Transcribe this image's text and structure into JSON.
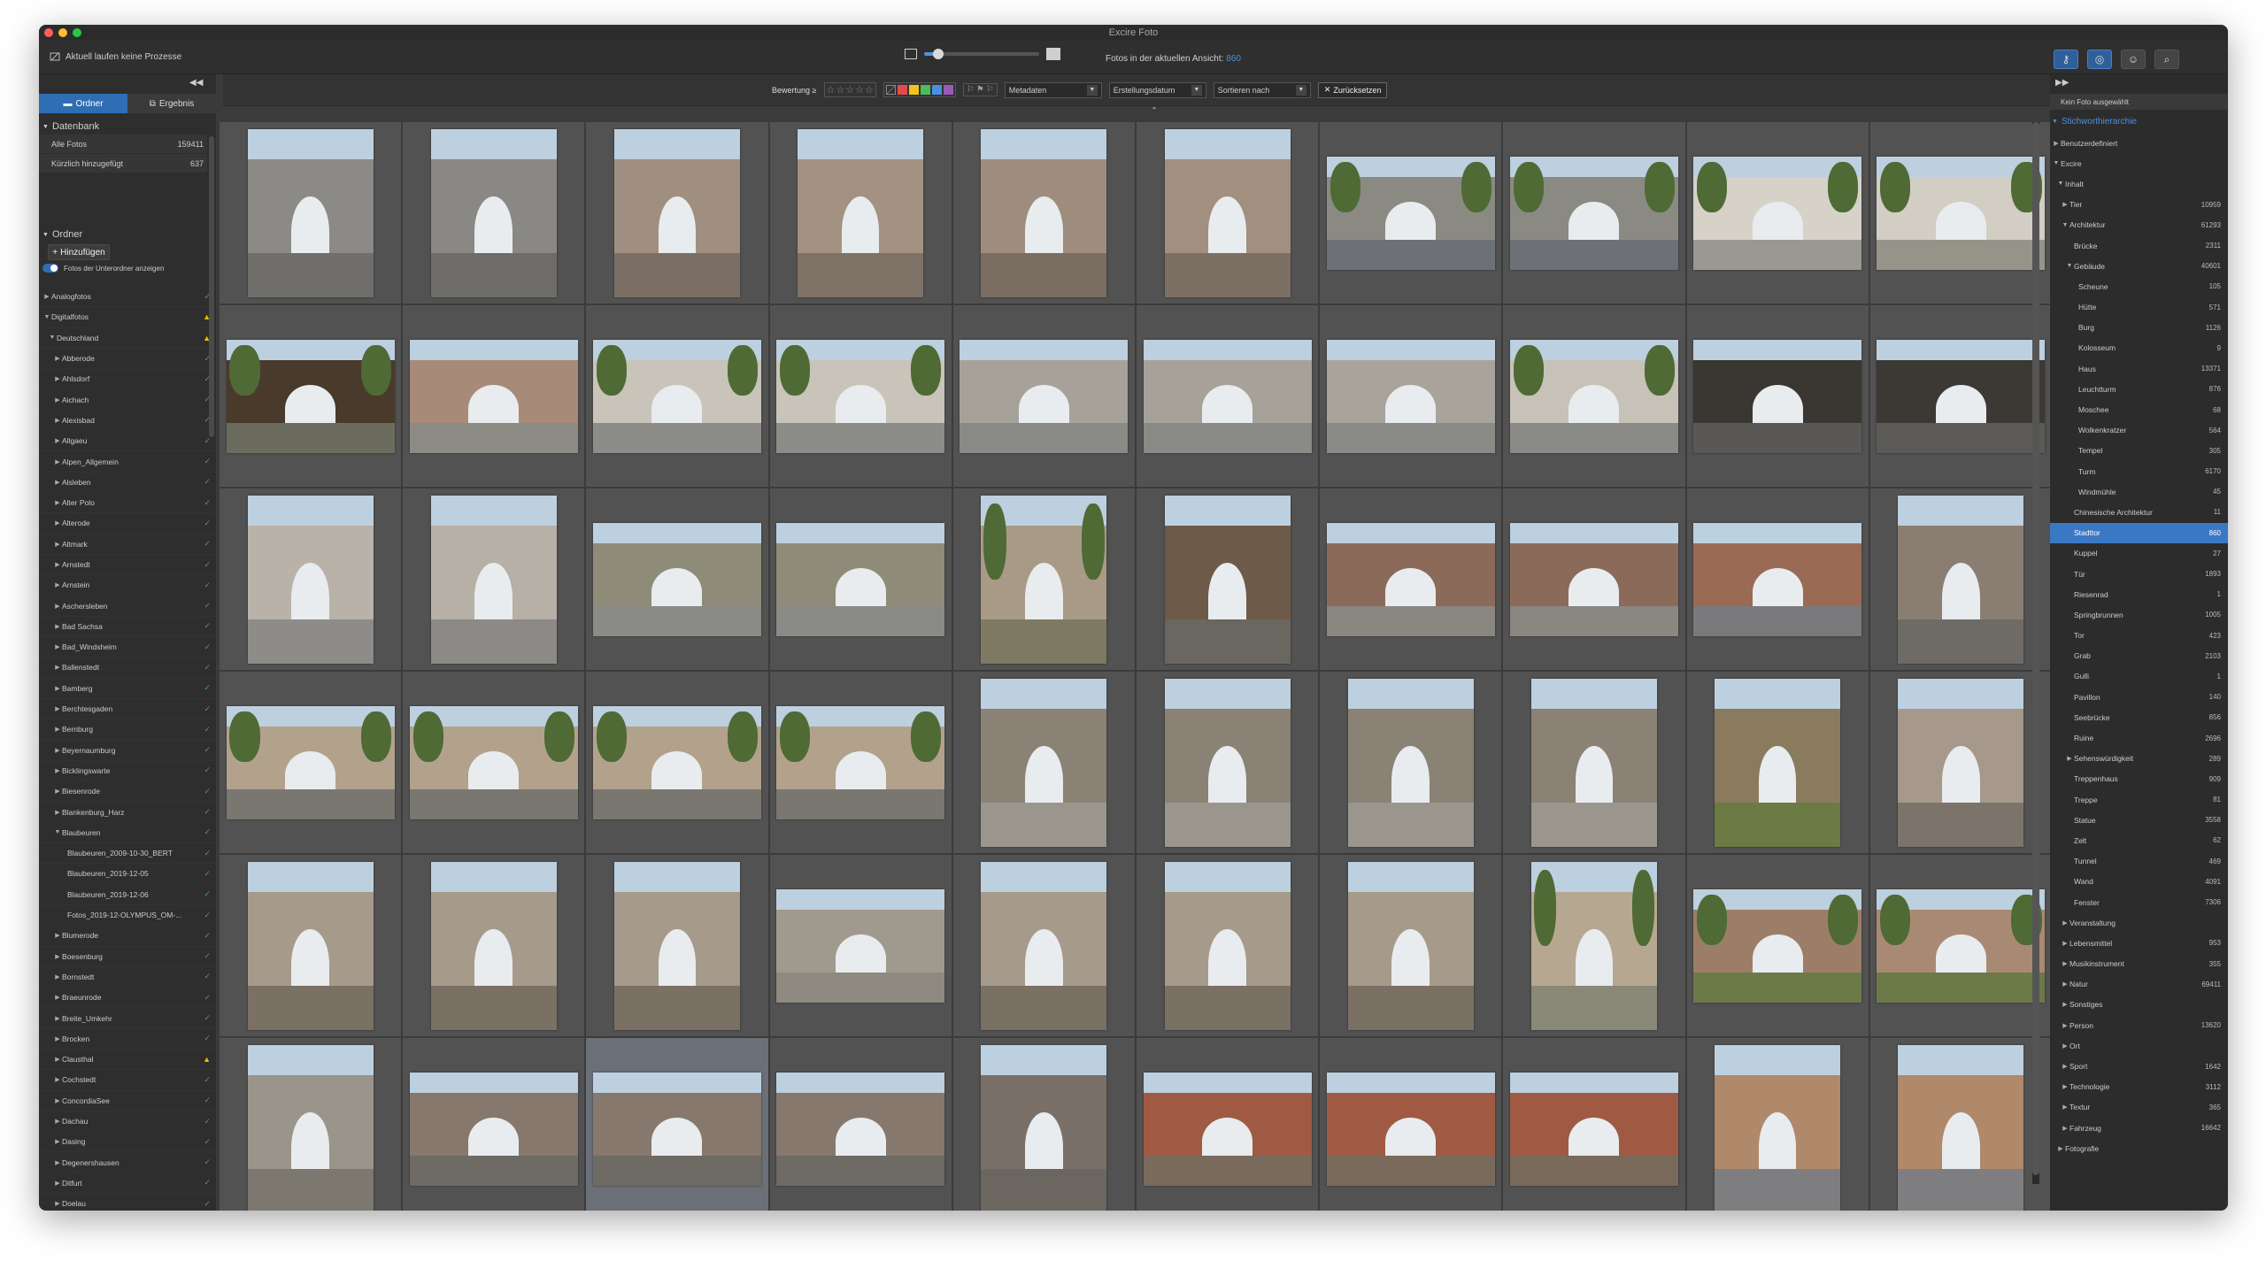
{
  "window": {
    "title": "Excire Foto",
    "traffic_colors": [
      "#ff5f57",
      "#febc2e",
      "#28c840"
    ]
  },
  "toolbar": {
    "process_status": "Aktuell laufen keine Prozesse",
    "count_label": "Fotos in der aktuellen Ansicht:",
    "count_value": "860",
    "zoom_level": 0.12,
    "right_buttons": [
      {
        "icon": "key-search-icon",
        "active": true
      },
      {
        "icon": "refresh-search-icon",
        "active": true
      },
      {
        "icon": "people-icon",
        "active": false
      },
      {
        "icon": "magnifier-icon",
        "active": false
      }
    ]
  },
  "left": {
    "tabs": [
      {
        "label": "Ordner",
        "icon": "folder-icon",
        "active": true
      },
      {
        "label": "Ergebnis",
        "icon": "results-icon",
        "active": false
      }
    ],
    "database": {
      "heading": "Datenbank",
      "rows": [
        {
          "label": "Alle Fotos",
          "count": "159411"
        },
        {
          "label": "Kürzlich hinzugefügt",
          "count": "637"
        }
      ]
    },
    "folders_heading": "Ordner",
    "add_label": "Hinzufügen",
    "subfolder_toggle": "Fotos der Unterordner anzeigen",
    "folders": [
      {
        "label": "Analogfotos",
        "level": 0,
        "arrow": "▶",
        "status": "ok"
      },
      {
        "label": "Digitalfotos",
        "level": 0,
        "arrow": "▼",
        "status": "warn"
      },
      {
        "label": "Deutschland",
        "level": 1,
        "arrow": "▼",
        "status": "warn"
      },
      {
        "label": "Abberode",
        "level": 2,
        "arrow": "▶",
        "status": "ok"
      },
      {
        "label": "Ahlsdorf",
        "level": 2,
        "arrow": "▶",
        "status": "ok"
      },
      {
        "label": "Aichach",
        "level": 2,
        "arrow": "▶",
        "status": "ok"
      },
      {
        "label": "Alexisbad",
        "level": 2,
        "arrow": "▶",
        "status": "ok"
      },
      {
        "label": "Allgaeu",
        "level": 2,
        "arrow": "▶",
        "status": "ok"
      },
      {
        "label": "Alpen_Allgemein",
        "level": 2,
        "arrow": "▶",
        "status": "ok"
      },
      {
        "label": "Alsleben",
        "level": 2,
        "arrow": "▶",
        "status": "ok"
      },
      {
        "label": "Alter Polo",
        "level": 2,
        "arrow": "▶",
        "status": "ok"
      },
      {
        "label": "Alterode",
        "level": 2,
        "arrow": "▶",
        "status": "ok"
      },
      {
        "label": "Altmark",
        "level": 2,
        "arrow": "▶",
        "status": "ok"
      },
      {
        "label": "Arnstedt",
        "level": 2,
        "arrow": "▶",
        "status": "ok"
      },
      {
        "label": "Arnstein",
        "level": 2,
        "arrow": "▶",
        "status": "ok"
      },
      {
        "label": "Aschersleben",
        "level": 2,
        "arrow": "▶",
        "status": "ok"
      },
      {
        "label": "Bad Sachsa",
        "level": 2,
        "arrow": "▶",
        "status": "ok"
      },
      {
        "label": "Bad_Windsheim",
        "level": 2,
        "arrow": "▶",
        "status": "ok"
      },
      {
        "label": "Ballenstedt",
        "level": 2,
        "arrow": "▶",
        "status": "ok"
      },
      {
        "label": "Bamberg",
        "level": 2,
        "arrow": "▶",
        "status": "ok"
      },
      {
        "label": "Berchtesgaden",
        "level": 2,
        "arrow": "▶",
        "status": "ok"
      },
      {
        "label": "Bernburg",
        "level": 2,
        "arrow": "▶",
        "status": "ok"
      },
      {
        "label": "Beyernaumburg",
        "level": 2,
        "arrow": "▶",
        "status": "ok"
      },
      {
        "label": "Bicklingswarte",
        "level": 2,
        "arrow": "▶",
        "status": "ok"
      },
      {
        "label": "Biesenrode",
        "level": 2,
        "arrow": "▶",
        "status": "ok"
      },
      {
        "label": "Blankenburg_Harz",
        "level": 2,
        "arrow": "▶",
        "status": "ok"
      },
      {
        "label": "Blaubeuren",
        "level": 2,
        "arrow": "▼",
        "status": "ok"
      },
      {
        "label": "Blaubeuren_2009-10-30_BERT",
        "level": 3,
        "arrow": "",
        "status": "ok"
      },
      {
        "label": "Blaubeuren_2019-12-05",
        "level": 3,
        "arrow": "",
        "status": "ok"
      },
      {
        "label": "Blaubeuren_2019-12-06",
        "level": 3,
        "arrow": "",
        "status": "ok"
      },
      {
        "label": "Fotos_2019-12-OLYMPUS_OM-...",
        "level": 3,
        "arrow": "",
        "status": "ok"
      },
      {
        "label": "Blumerode",
        "level": 2,
        "arrow": "▶",
        "status": "ok"
      },
      {
        "label": "Boesenburg",
        "level": 2,
        "arrow": "▶",
        "status": "ok"
      },
      {
        "label": "Bornstedt",
        "level": 2,
        "arrow": "▶",
        "status": "ok"
      },
      {
        "label": "Braeunrode",
        "level": 2,
        "arrow": "▶",
        "status": "ok"
      },
      {
        "label": "Breite_Umkehr",
        "level": 2,
        "arrow": "▶",
        "status": "ok"
      },
      {
        "label": "Brocken",
        "level": 2,
        "arrow": "▶",
        "status": "ok"
      },
      {
        "label": "Clausthal",
        "level": 2,
        "arrow": "▶",
        "status": "warn"
      },
      {
        "label": "Cochstedt",
        "level": 2,
        "arrow": "▶",
        "status": "ok"
      },
      {
        "label": "ConcordiaSee",
        "level": 2,
        "arrow": "▶",
        "status": "ok"
      },
      {
        "label": "Dachau",
        "level": 2,
        "arrow": "▶",
        "status": "ok"
      },
      {
        "label": "Dasing",
        "level": 2,
        "arrow": "▶",
        "status": "ok"
      },
      {
        "label": "Degenershausen",
        "level": 2,
        "arrow": "▶",
        "status": "ok"
      },
      {
        "label": "Ditfurt",
        "level": 2,
        "arrow": "▶",
        "status": "ok"
      },
      {
        "label": "Doelau",
        "level": 2,
        "arrow": "▶",
        "status": "ok"
      }
    ]
  },
  "filter": {
    "rating_label": "Bewertung",
    "rating_op": "≥",
    "color_labels": [
      "#e14b4b",
      "#f0c419",
      "#4cbb5c",
      "#4a90e2",
      "#9b59b6"
    ],
    "dropdowns": [
      "Metadaten",
      "Erstellungsdatum",
      "Sortieren nach"
    ],
    "reset_label": "Zurücksetzen"
  },
  "grid": {
    "selected_index": 52,
    "thumbs": [
      {
        "o": "port",
        "c": "#8c8a86",
        "g": "#6f6e6a"
      },
      {
        "o": "port",
        "c": "#8a8884",
        "g": "#6d6c68"
      },
      {
        "o": "port",
        "c": "#a08f80",
        "g": "#7b6f65"
      },
      {
        "o": "port",
        "c": "#a39281",
        "g": "#7e7166"
      },
      {
        "o": "port",
        "c": "#9e8d7e",
        "g": "#7a6d62"
      },
      {
        "o": "port",
        "c": "#a19080",
        "g": "#7c6f64"
      },
      {
        "o": "land",
        "c": "#8a8a82",
        "g": "#6d7076",
        "t": 1
      },
      {
        "o": "land",
        "c": "#8a8a82",
        "g": "#6d7076",
        "t": 1
      },
      {
        "o": "land",
        "c": "#d6d2c8",
        "g": "#9a9890",
        "t": 1
      },
      {
        "o": "land",
        "c": "#d2cec4",
        "g": "#969488",
        "t": 1
      },
      {
        "o": "land",
        "c": "#4a3a2c",
        "g": "#6c6c5e",
        "t": 1
      },
      {
        "o": "land",
        "c": "#a88a78",
        "g": "#8c8c84"
      },
      {
        "o": "land",
        "c": "#c8c4ba",
        "g": "#8c8c88",
        "t": 1
      },
      {
        "o": "land",
        "c": "#c8c4ba",
        "g": "#8c8c88",
        "t": 1
      },
      {
        "o": "land",
        "c": "#a6a29a",
        "g": "#8a8a86"
      },
      {
        "o": "land",
        "c": "#a6a29a",
        "g": "#8a8a86"
      },
      {
        "o": "land",
        "c": "#a8a49c",
        "g": "#8a8a86"
      },
      {
        "o": "land",
        "c": "#c6c2b8",
        "g": "#8a8a86",
        "t": 1
      },
      {
        "o": "land",
        "c": "#3a3632",
        "g": "#5a5854"
      },
      {
        "o": "land",
        "c": "#3c3834",
        "g": "#5c5a56"
      },
      {
        "o": "port",
        "c": "#b8b2a8",
        "g": "#8e8c88"
      },
      {
        "o": "port",
        "c": "#b6b0a6",
        "g": "#8c8a86"
      },
      {
        "o": "land",
        "c": "#8e8c78",
        "g": "#8a8a86"
      },
      {
        "o": "land",
        "c": "#8e8c78",
        "g": "#8a8a86"
      },
      {
        "o": "port",
        "c": "#a89a86",
        "g": "#7e7a62",
        "t": 1
      },
      {
        "o": "port",
        "c": "#6e5a48",
        "g": "#6a6660"
      },
      {
        "o": "land",
        "c": "#8c6a5a",
        "g": "#8a8680"
      },
      {
        "o": "land",
        "c": "#8c6a5a",
        "g": "#8a8680"
      },
      {
        "o": "land",
        "c": "#9a6a54",
        "g": "#7a7a7c"
      },
      {
        "o": "port",
        "c": "#8a7e72",
        "g": "#6e6a66"
      },
      {
        "o": "land",
        "c": "#b2a28c",
        "g": "#7a7670",
        "t": 1
      },
      {
        "o": "land",
        "c": "#b2a28c",
        "g": "#7a7670",
        "t": 1
      },
      {
        "o": "land",
        "c": "#b2a28c",
        "g": "#7a7670",
        "t": 1
      },
      {
        "o": "land",
        "c": "#b2a28c",
        "g": "#7a7670",
        "t": 1
      },
      {
        "o": "port",
        "c": "#8a8274",
        "g": "#9a968e"
      },
      {
        "o": "port",
        "c": "#8a8274",
        "g": "#9a968e"
      },
      {
        "o": "port",
        "c": "#8a8274",
        "g": "#9a968e"
      },
      {
        "o": "port",
        "c": "#8a8274",
        "g": "#9a968e"
      },
      {
        "o": "port",
        "c": "#8a7a5e",
        "g": "#6c7a44"
      },
      {
        "o": "port",
        "c": "#a6988a",
        "g": "#7c746a"
      },
      {
        "o": "port",
        "c": "#a69a8a",
        "g": "#7a7064"
      },
      {
        "o": "port",
        "c": "#a69a8a",
        "g": "#7a7064"
      },
      {
        "o": "port",
        "c": "#a69a8a",
        "g": "#7a7064"
      },
      {
        "o": "land",
        "c": "#a09a8e",
        "g": "#8e8a80"
      },
      {
        "o": "port",
        "c": "#a69a8a",
        "g": "#7a7064"
      },
      {
        "o": "port",
        "c": "#a69a8a",
        "g": "#7a7064"
      },
      {
        "o": "port",
        "c": "#a69a8a",
        "g": "#7a7064"
      },
      {
        "o": "port",
        "c": "#b6a890",
        "g": "#8a8878",
        "t": 1
      },
      {
        "o": "land",
        "c": "#9c7e68",
        "g": "#6c7a4a",
        "t": 1
      },
      {
        "o": "land",
        "c": "#a88a74",
        "g": "#6c7a4a",
        "t": 1
      },
      {
        "o": "port",
        "c": "#9a948a",
        "g": "#7c7870"
      },
      {
        "o": "land",
        "c": "#86786c",
        "g": "#6e6a64"
      },
      {
        "o": "land",
        "c": "#86786c",
        "g": "#6e6a64"
      },
      {
        "o": "land",
        "c": "#86786c",
        "g": "#6e6a64"
      },
      {
        "o": "port",
        "c": "#7a7068",
        "g": "#6c6660"
      },
      {
        "o": "land",
        "c": "#a05a44",
        "g": "#7a6a5c"
      },
      {
        "o": "land",
        "c": "#a05a44",
        "g": "#7a6a5c"
      },
      {
        "o": "land",
        "c": "#a05a44",
        "g": "#7a6a5c"
      },
      {
        "o": "port",
        "c": "#b0886a",
        "g": "#7e7e80"
      },
      {
        "o": "port",
        "c": "#b0886a",
        "g": "#7e7e80"
      }
    ]
  },
  "right": {
    "no_photo": "Kein Foto ausgewählt",
    "heading": "Stichworthierarchie",
    "keywords": [
      {
        "label": "Benutzerdefiniert",
        "level": 0,
        "arrow": "▶",
        "count": ""
      },
      {
        "label": "Excire",
        "level": 0,
        "arrow": "▼",
        "count": ""
      },
      {
        "label": "Inhalt",
        "level": 1,
        "arrow": "▼",
        "count": ""
      },
      {
        "label": "Tier",
        "level": 2,
        "arrow": "▶",
        "count": "10959"
      },
      {
        "label": "Architektur",
        "level": 2,
        "arrow": "▼",
        "count": "61293"
      },
      {
        "label": "Brücke",
        "level": 3,
        "arrow": "",
        "count": "2311"
      },
      {
        "label": "Gebäude",
        "level": 3,
        "arrow": "▼",
        "count": "40601"
      },
      {
        "label": "Scheune",
        "level": 4,
        "arrow": "",
        "count": "105"
      },
      {
        "label": "Hütte",
        "level": 4,
        "arrow": "",
        "count": "571"
      },
      {
        "label": "Burg",
        "level": 4,
        "arrow": "",
        "count": "1126"
      },
      {
        "label": "Kolosseum",
        "level": 4,
        "arrow": "",
        "count": "9"
      },
      {
        "label": "Haus",
        "level": 4,
        "arrow": "",
        "count": "13371"
      },
      {
        "label": "Leuchtturm",
        "level": 4,
        "arrow": "",
        "count": "876"
      },
      {
        "label": "Moschee",
        "level": 4,
        "arrow": "",
        "count": "68"
      },
      {
        "label": "Wolkenkratzer",
        "level": 4,
        "arrow": "",
        "count": "564"
      },
      {
        "label": "Tempel",
        "level": 4,
        "arrow": "",
        "count": "305"
      },
      {
        "label": "Turm",
        "level": 4,
        "arrow": "",
        "count": "6170"
      },
      {
        "label": "Windmühle",
        "level": 4,
        "arrow": "",
        "count": "45"
      },
      {
        "label": "Chinesische Architektur",
        "level": 3,
        "arrow": "",
        "count": "11"
      },
      {
        "label": "Stadttor",
        "level": 3,
        "arrow": "",
        "count": "860",
        "selected": true
      },
      {
        "label": "Kuppel",
        "level": 3,
        "arrow": "",
        "count": "27"
      },
      {
        "label": "Tür",
        "level": 3,
        "arrow": "",
        "count": "1893"
      },
      {
        "label": "Riesenrad",
        "level": 3,
        "arrow": "",
        "count": "1"
      },
      {
        "label": "Springbrunnen",
        "level": 3,
        "arrow": "",
        "count": "1005"
      },
      {
        "label": "Tor",
        "level": 3,
        "arrow": "",
        "count": "423"
      },
      {
        "label": "Grab",
        "level": 3,
        "arrow": "",
        "count": "2103"
      },
      {
        "label": "Gulli",
        "level": 3,
        "arrow": "",
        "count": "1"
      },
      {
        "label": "Pavillon",
        "level": 3,
        "arrow": "",
        "count": "140"
      },
      {
        "label": "Seebrücke",
        "level": 3,
        "arrow": "",
        "count": "856"
      },
      {
        "label": "Ruine",
        "level": 3,
        "arrow": "",
        "count": "2696"
      },
      {
        "label": "Sehenswürdigkeit",
        "level": 3,
        "arrow": "▶",
        "count": "289"
      },
      {
        "label": "Treppenhaus",
        "level": 3,
        "arrow": "",
        "count": "909"
      },
      {
        "label": "Treppe",
        "level": 3,
        "arrow": "",
        "count": "81"
      },
      {
        "label": "Statue",
        "level": 3,
        "arrow": "",
        "count": "3558"
      },
      {
        "label": "Zelt",
        "level": 3,
        "arrow": "",
        "count": "62"
      },
      {
        "label": "Tunnel",
        "level": 3,
        "arrow": "",
        "count": "469"
      },
      {
        "label": "Wand",
        "level": 3,
        "arrow": "",
        "count": "4091"
      },
      {
        "label": "Fenster",
        "level": 3,
        "arrow": "",
        "count": "7306"
      },
      {
        "label": "Veranstaltung",
        "level": 2,
        "arrow": "▶",
        "count": ""
      },
      {
        "label": "Lebensmittel",
        "level": 2,
        "arrow": "▶",
        "count": "953"
      },
      {
        "label": "Musikinstrument",
        "level": 2,
        "arrow": "▶",
        "count": "355"
      },
      {
        "label": "Natur",
        "level": 2,
        "arrow": "▶",
        "count": "69411"
      },
      {
        "label": "Sonstiges",
        "level": 2,
        "arrow": "▶",
        "count": ""
      },
      {
        "label": "Person",
        "level": 2,
        "arrow": "▶",
        "count": "13620"
      },
      {
        "label": "Ort",
        "level": 2,
        "arrow": "▶",
        "count": ""
      },
      {
        "label": "Sport",
        "level": 2,
        "arrow": "▶",
        "count": "1642"
      },
      {
        "label": "Technologie",
        "level": 2,
        "arrow": "▶",
        "count": "3112"
      },
      {
        "label": "Textur",
        "level": 2,
        "arrow": "▶",
        "count": "365"
      },
      {
        "label": "Fahrzeug",
        "level": 2,
        "arrow": "▶",
        "count": "16642"
      },
      {
        "label": "Fotografie",
        "level": 1,
        "arrow": "▶",
        "count": ""
      }
    ]
  }
}
